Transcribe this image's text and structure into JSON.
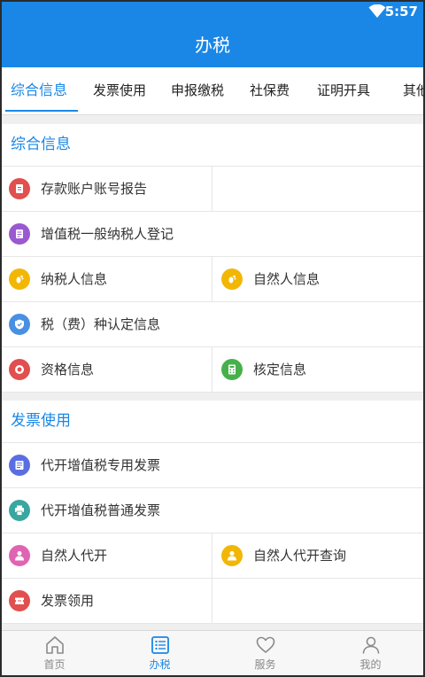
{
  "status_bar": {
    "time": "5:57"
  },
  "app_bar": {
    "title": "办税"
  },
  "tabs": [
    {
      "label": "综合信息",
      "active": true
    },
    {
      "label": "发票使用",
      "active": false
    },
    {
      "label": "申报缴税",
      "active": false
    },
    {
      "label": "社保费",
      "active": false
    },
    {
      "label": "证明开具",
      "active": false
    },
    {
      "label": "其他",
      "active": false
    }
  ],
  "sections": [
    {
      "title": "综合信息",
      "items": [
        {
          "label": "存款账户账号报告",
          "icon": "document-icon",
          "color": "#e14f4f"
        },
        {
          "label": "增值税一般纳税人登记",
          "icon": "form-icon",
          "color": "#9b59d0"
        },
        {
          "label": "纳税人信息",
          "icon": "footprint-icon",
          "color": "#f2b705"
        },
        {
          "label": "自然人信息",
          "icon": "footprint-icon",
          "color": "#f2b705"
        },
        {
          "label": "税（费）种认定信息",
          "icon": "shield-icon",
          "color": "#4a90e2"
        },
        {
          "label": "资格信息",
          "icon": "badge-icon",
          "color": "#e14f4f"
        },
        {
          "label": "核定信息",
          "icon": "calculator-icon",
          "color": "#47b04b"
        }
      ]
    },
    {
      "title": "发票使用",
      "items": [
        {
          "label": "代开增值税专用发票",
          "icon": "invoice-icon",
          "color": "#5b6ee1"
        },
        {
          "label": "代开增值税普通发票",
          "icon": "printer-icon",
          "color": "#3aa6a0"
        },
        {
          "label": "自然人代开",
          "icon": "person-icon",
          "color": "#e064b4"
        },
        {
          "label": "自然人代开查询",
          "icon": "person-icon",
          "color": "#f2b705"
        },
        {
          "label": "发票领用",
          "icon": "ticket-icon",
          "color": "#e14f4f"
        }
      ]
    }
  ],
  "bottom_nav": [
    {
      "label": "首页",
      "icon": "home-icon",
      "active": false
    },
    {
      "label": "办税",
      "icon": "list-icon",
      "active": true
    },
    {
      "label": "服务",
      "icon": "heart-icon",
      "active": false
    },
    {
      "label": "我的",
      "icon": "user-icon",
      "active": false
    }
  ],
  "colors": {
    "accent": "#1a87e6",
    "background": "#efefef"
  }
}
